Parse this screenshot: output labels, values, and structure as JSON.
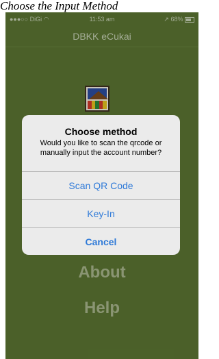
{
  "caption": "Choose the Input Method",
  "status_bar": {
    "carrier": "●●●○○ DiGi ",
    "time": "11:53 am",
    "battery": "68%"
  },
  "nav": {
    "title": "DBKK eCukai"
  },
  "menu": {
    "about": "About",
    "help": "Help"
  },
  "alert": {
    "title": "Choose method",
    "message": "Would you like to scan the qrcode or manually input the account number?",
    "buttons": {
      "scan": "Scan QR Code",
      "keyin": "Key-In",
      "cancel": "Cancel"
    }
  },
  "colors": {
    "background": "#5c7632",
    "alert_bg": "#ebebeb",
    "button_text": "#2f7ad8",
    "menu_text": "#a9b68d"
  }
}
